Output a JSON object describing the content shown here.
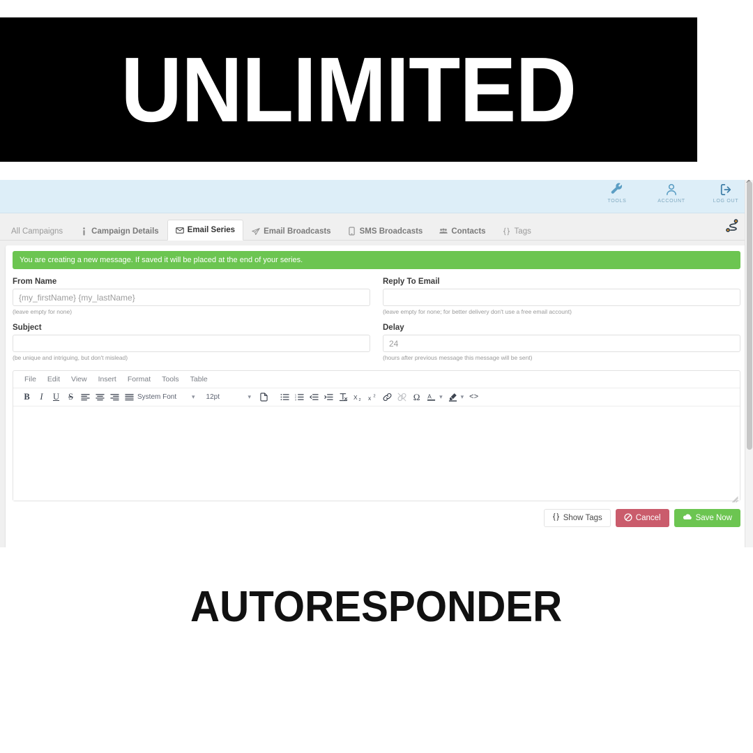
{
  "promo": {
    "top_headline": "UNLIMITED",
    "bottom_headline": "AUTORESPONDER"
  },
  "utility_bar": {
    "items": [
      {
        "label": "TOOLS",
        "icon": "wrench-icon"
      },
      {
        "label": "ACCOUNT",
        "icon": "user-icon"
      },
      {
        "label": "LOG OUT",
        "icon": "logout-icon"
      }
    ]
  },
  "tabs": [
    {
      "label": "All Campaigns",
      "icon": "",
      "active": false,
      "style": "plain"
    },
    {
      "label": "Campaign Details",
      "icon": "info-icon",
      "active": false,
      "style": "strong"
    },
    {
      "label": "Email Series",
      "icon": "envelope-icon",
      "active": true,
      "style": "strong"
    },
    {
      "label": "Email Broadcasts",
      "icon": "paper-plane-icon",
      "active": false,
      "style": "strong"
    },
    {
      "label": "SMS Broadcasts",
      "icon": "mobile-icon",
      "active": false,
      "style": "strong"
    },
    {
      "label": "Contacts",
      "icon": "users-icon",
      "active": false,
      "style": "strong"
    },
    {
      "label": "Tags",
      "icon": "braces-icon",
      "active": false,
      "style": "plain"
    }
  ],
  "tabstrip_right_icon": "funnel-route-icon",
  "alert": {
    "text": "You are creating a new message. If saved it will be placed at the end of your series.",
    "color": "#6cc551"
  },
  "form": {
    "from_name": {
      "label": "From Name",
      "value": "",
      "placeholder": "{my_firstName} {my_lastName}",
      "hint": "(leave empty for none)"
    },
    "reply_to_email": {
      "label": "Reply To Email",
      "value": "",
      "placeholder": "",
      "hint": "(leave empty for none; for better delivery don't use a free email account)"
    },
    "subject": {
      "label": "Subject",
      "value": "",
      "placeholder": "",
      "hint": "(be unique and intriguing, but don't mislead)"
    },
    "delay": {
      "label": "Delay",
      "value": "",
      "placeholder": "24",
      "hint": "(hours after previous message this message will be sent)"
    }
  },
  "editor": {
    "menus": [
      "File",
      "Edit",
      "View",
      "Insert",
      "Format",
      "Tools",
      "Table"
    ],
    "font_name": "System Font",
    "font_size": "12pt",
    "body_value": "",
    "toolbar": [
      {
        "name": "bold-icon",
        "glyph": "B"
      },
      {
        "name": "italic-icon",
        "glyph": "I"
      },
      {
        "name": "underline-icon",
        "glyph": "U"
      },
      {
        "name": "strikethrough-icon",
        "glyph": "S"
      },
      {
        "name": "align-left-icon",
        "glyph": ""
      },
      {
        "name": "align-center-icon",
        "glyph": ""
      },
      {
        "name": "align-right-icon",
        "glyph": ""
      },
      {
        "name": "align-justify-icon",
        "glyph": ""
      },
      {
        "name": "source-document-icon",
        "glyph": ""
      },
      {
        "name": "bullet-list-icon",
        "glyph": ""
      },
      {
        "name": "numbered-list-icon",
        "glyph": ""
      },
      {
        "name": "outdent-icon",
        "glyph": ""
      },
      {
        "name": "indent-icon",
        "glyph": ""
      },
      {
        "name": "clear-formatting-icon",
        "glyph": ""
      },
      {
        "name": "subscript-icon",
        "glyph": ""
      },
      {
        "name": "superscript-icon",
        "glyph": ""
      },
      {
        "name": "link-icon",
        "glyph": ""
      },
      {
        "name": "unlink-icon",
        "glyph": ""
      },
      {
        "name": "special-character-icon",
        "glyph": "Ω"
      },
      {
        "name": "text-color-icon",
        "glyph": "A"
      },
      {
        "name": "highlight-color-icon",
        "glyph": ""
      },
      {
        "name": "source-code-icon",
        "glyph": "<>"
      }
    ]
  },
  "actions": {
    "show_tags": {
      "label": "Show Tags",
      "icon": "braces-icon"
    },
    "cancel": {
      "label": "Cancel",
      "icon": "ban-icon",
      "color": "#ca5c6c"
    },
    "save_now": {
      "label": "Save Now",
      "icon": "cloud-icon",
      "color": "#6cc551"
    }
  }
}
